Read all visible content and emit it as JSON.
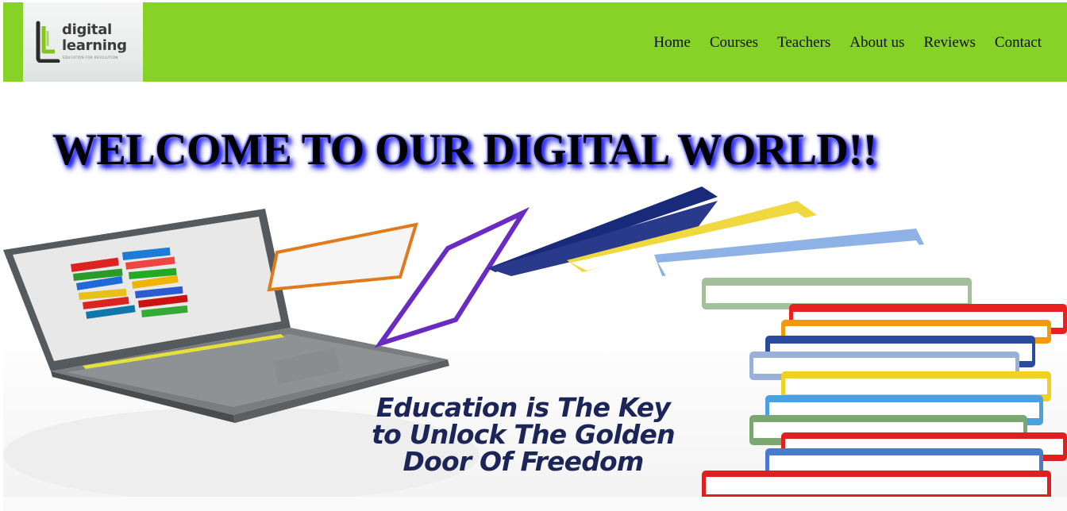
{
  "brand": {
    "name_line1": "digital",
    "name_line2": "learning",
    "tagline": "EDUCATION FOR REVOLUTION",
    "logo_icon": "book-l-logo-icon"
  },
  "nav": {
    "items": [
      {
        "label": "Home"
      },
      {
        "label": "Courses"
      },
      {
        "label": "Teachers"
      },
      {
        "label": "About us"
      },
      {
        "label": "Reviews"
      },
      {
        "label": "Contact"
      }
    ]
  },
  "hero": {
    "title": "WELCOME TO OUR DIGITAL WORLD!!",
    "quote_line1": "Education is The Key",
    "quote_line2": "to Unlock The Golden",
    "quote_line3": "Door Of Freedom"
  },
  "colors": {
    "navbar": "#86d227",
    "title_glow": "#2a2aff",
    "quote_text": "#1c2557"
  }
}
